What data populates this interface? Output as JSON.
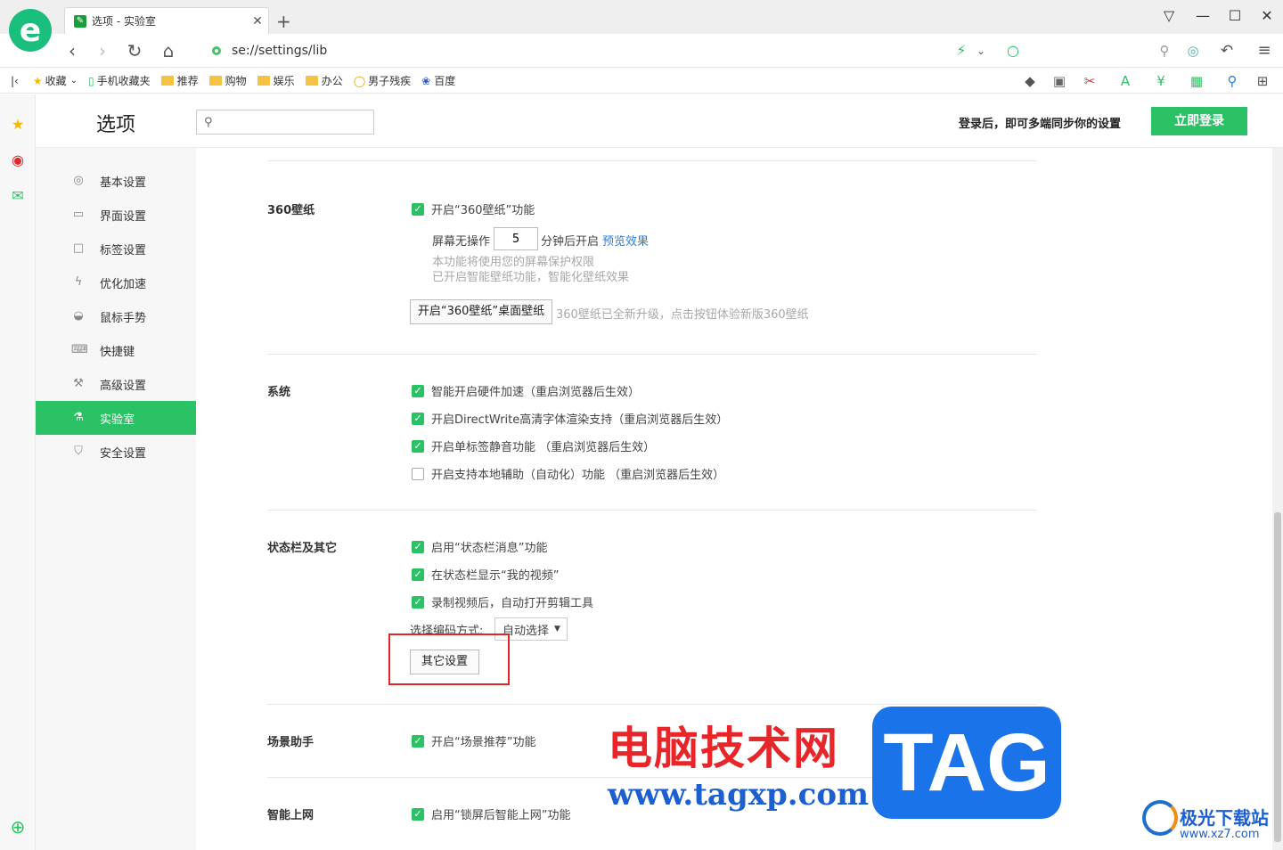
{
  "window": {
    "tab_title": "选项 - 实验室",
    "new_tab": "+",
    "minimize": "—",
    "maximize": "☐",
    "close": "✕",
    "pin": "▽"
  },
  "nav": {
    "url": "se://settings/lib"
  },
  "bookmarks": [
    "收藏",
    "手机收藏夹",
    "推荐",
    "购物",
    "娱乐",
    "办公",
    "男子残疾",
    "百度"
  ],
  "header": {
    "title": "选项",
    "search_placeholder": "",
    "login_msg": "登录后，即可多端同步你的设置",
    "login_btn": "立即登录"
  },
  "sidebar": {
    "items": [
      {
        "label": "基本设置",
        "icon": "gear-icon"
      },
      {
        "label": "界面设置",
        "icon": "window-icon"
      },
      {
        "label": "标签设置",
        "icon": "tab-icon"
      },
      {
        "label": "优化加速",
        "icon": "bolt-icon"
      },
      {
        "label": "鼠标手势",
        "icon": "mouse-icon"
      },
      {
        "label": "快捷键",
        "icon": "keyboard-icon"
      },
      {
        "label": "高级设置",
        "icon": "wrench-icon"
      },
      {
        "label": "实验室",
        "icon": "flask-icon"
      },
      {
        "label": "安全设置",
        "icon": "shield-icon"
      }
    ],
    "active": "实验室"
  },
  "wallpaper": {
    "label": "360壁纸",
    "enable": "开启“360壁纸”功能",
    "idle_prefix": "屏幕无操作",
    "idle_value": "5",
    "idle_suffix": "分钟后开启",
    "preview_link": "预览效果",
    "note1": "本功能将使用您的屏幕保护权限",
    "note2": "已开启智能壁纸功能，智能化壁纸效果",
    "desktop_btn": "开启“360壁纸”桌面壁纸",
    "upgrade_note": "360壁纸已全新升级，点击按钮体验新版360壁纸"
  },
  "system": {
    "label": "系统",
    "opts": [
      {
        "text": "智能开启硬件加速（重启浏览器后生效）",
        "checked": true
      },
      {
        "text": "开启DirectWrite高清字体渲染支持（重启浏览器后生效）",
        "checked": true
      },
      {
        "text": "开启单标签静音功能 （重启浏览器后生效）",
        "checked": true
      },
      {
        "text": "开启支持本地辅助（自动化）功能 （重启浏览器后生效）",
        "checked": false
      }
    ]
  },
  "statusbar": {
    "label": "状态栏及其它",
    "opts": [
      {
        "text": "启用“状态栏消息”功能",
        "checked": true
      },
      {
        "text": "在状态栏显示“我的视频”",
        "checked": true
      },
      {
        "text": "录制视频后，自动打开剪辑工具",
        "checked": true
      }
    ],
    "encode_label": "选择编码方式:",
    "encode_value": "自动选择",
    "other_btn": "其它设置"
  },
  "scene": {
    "label": "场景助手",
    "opt": "开启“场景推荐”功能"
  },
  "smartnet": {
    "label": "智能上网",
    "opt": "启用“锁屏后智能上网”功能"
  },
  "watermark": {
    "cn": "电脑技术网",
    "url": "www.tagxp.com",
    "tag": "TAG",
    "site2": "极光下载站",
    "site2_url": "www.xz7.com"
  },
  "colors": {
    "accent": "#2bc266",
    "highlight": "#e0262a"
  }
}
